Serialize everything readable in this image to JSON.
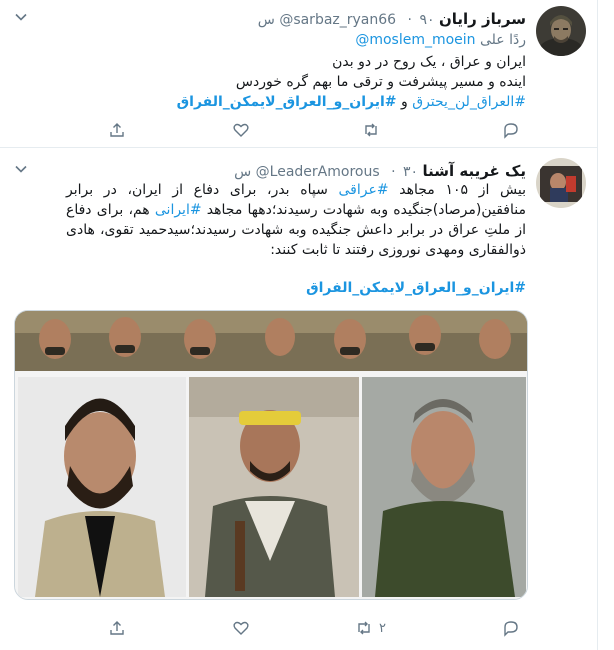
{
  "tweets": [
    {
      "name": "سرباز رایان",
      "handle": "@sarbaz_ryan66",
      "time": "۹۰ س",
      "replying_prefix": "ردًا على",
      "replying_to": "@moslem_moein",
      "lines": [
        "ایران و عراق ، یک روح در دو بدن",
        "اینده و مسیر پیشرفت و ترقی ما بهم گره خوردس"
      ],
      "hashtag1": "#العراق_لن_يحترق",
      "joiner": "و",
      "hashtag2": "#ایران_و_العراق_لایمکن_الفراق",
      "reply_count": "",
      "retweet_count": "",
      "like_count": ""
    },
    {
      "name": "یک غریبه آشنا",
      "handle": "@LeaderAmorous",
      "time": "۳۰ س",
      "text_p1": "بیش از ۱۰۵ مجاهد ",
      "tag_iraqi": "#عراقی",
      "text_p2": " سپاه بدر، برای دفاع از ایران، در برابر منافقین(مرصاد)جنگیده وبه شهادت رسیدند؛دهها مجاهد ",
      "tag_irani": "#ایرانی",
      "text_p3": " هم، برای دفاع از ملتِ عراق در برابر داعش جنگیده وبه شهادت رسیدند؛سیدحمید تقوی، هادی ذوالفقاری ومهدی نوروزی رفتند تا ثابت کنند:",
      "hashtag": "#ایران_و_العراق_لایمکن_الفراق",
      "reply_count": "",
      "retweet_count": "۲",
      "like_count": ""
    }
  ],
  "colors": {
    "link": "#1b95e0",
    "muted": "#657786",
    "border": "#e6ecf0",
    "text": "#14171a"
  },
  "icons": [
    "chevron-down-icon",
    "reply-icon",
    "retweet-icon",
    "like-icon",
    "share-icon"
  ]
}
